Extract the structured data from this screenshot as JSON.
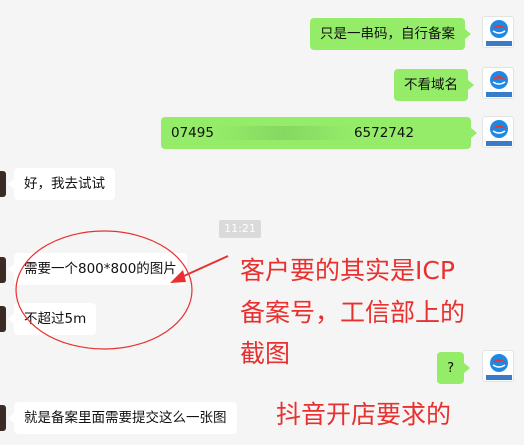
{
  "chat": {
    "messages": [
      {
        "side": "sent",
        "text": "只是一串码，自行备案"
      },
      {
        "side": "sent",
        "text": "不看域名"
      },
      {
        "side": "sent",
        "text_start": "07495",
        "text_end": "6572742"
      },
      {
        "side": "received",
        "text": "好，我去试试"
      },
      {
        "side": "received",
        "text": "需要一个800*800的图片"
      },
      {
        "side": "received",
        "text": "不超过5m"
      },
      {
        "side": "sent",
        "text": "?"
      },
      {
        "side": "received",
        "text": "就是备案里面需要提交这么一张图"
      }
    ],
    "timestamp": "11:21"
  },
  "avatar": {
    "brand_text": "鸿鹄梦科技"
  },
  "annotations": {
    "note_line1": "客户要的其实是ICP",
    "note_line2": "备案号，工信部上的",
    "note_line3": "截图",
    "note_bottom": "抖音开店要求的"
  },
  "colors": {
    "sent_bubble": "#95ec69",
    "received_bubble": "#ffffff",
    "background": "#f5f5f5",
    "annotation_red": "#e8312f"
  }
}
